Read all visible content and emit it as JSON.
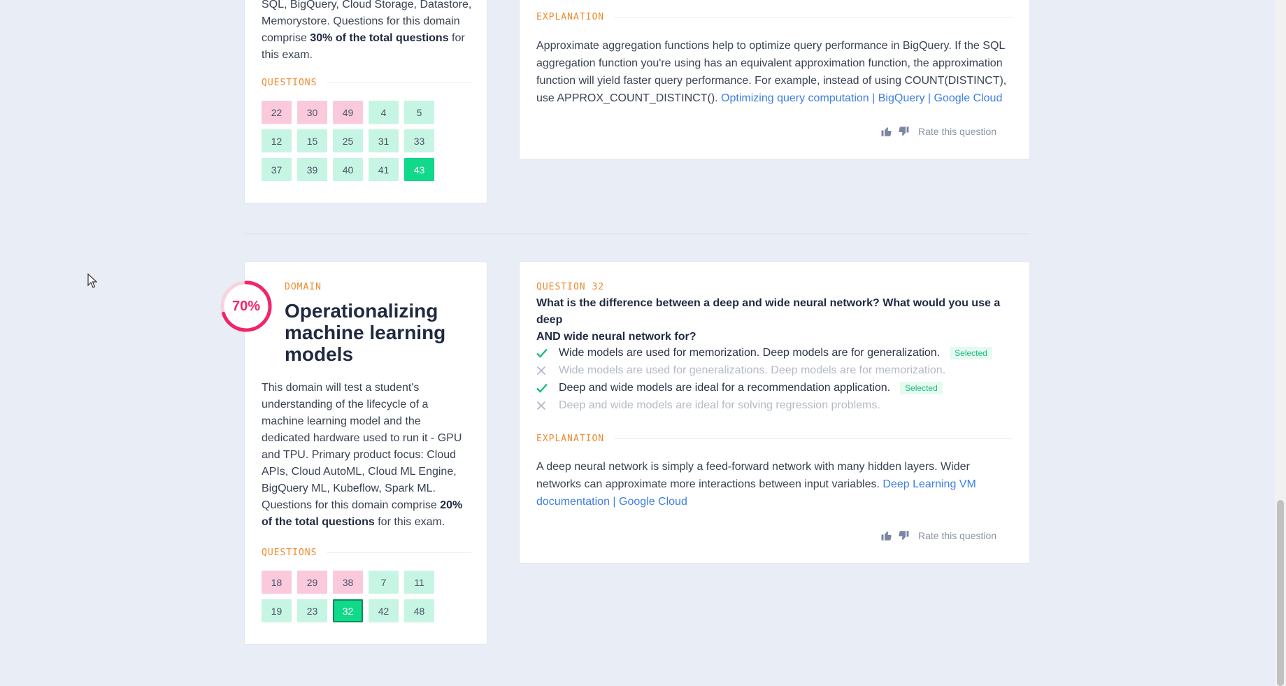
{
  "colors": {
    "accent_orange": "#f08a2d",
    "pink": "#fbc9dc",
    "green_light": "#c7f5e3",
    "green_active": "#10d98a",
    "link": "#3d7ee0",
    "donut": "#f0256a"
  },
  "domain1": {
    "desc_lines": [
      "SQL, BigQuery, Cloud Storage, Datastore,",
      "Memorystore. Questions for this domain"
    ],
    "desc_pre": "comprise ",
    "desc_bold": "30% of the total questions",
    "desc_post": " for",
    "desc_last": "this exam.",
    "questions_label": "QUESTIONS",
    "questions": [
      {
        "n": "22",
        "s": "pink"
      },
      {
        "n": "30",
        "s": "pink"
      },
      {
        "n": "49",
        "s": "pink"
      },
      {
        "n": "4",
        "s": "green"
      },
      {
        "n": "5",
        "s": "green"
      },
      {
        "n": "12",
        "s": "green"
      },
      {
        "n": "15",
        "s": "green"
      },
      {
        "n": "25",
        "s": "green"
      },
      {
        "n": "31",
        "s": "green"
      },
      {
        "n": "33",
        "s": "green"
      },
      {
        "n": "37",
        "s": "green"
      },
      {
        "n": "39",
        "s": "green"
      },
      {
        "n": "40",
        "s": "green"
      },
      {
        "n": "41",
        "s": "green"
      },
      {
        "n": "43",
        "s": "active"
      }
    ]
  },
  "explanation1": {
    "label": "EXPLANATION",
    "lines": [
      "Approximate aggregation functions help to optimize query performance in BigQuery. If the SQL",
      "aggregation function you're using has an equivalent approximation function, the approximation",
      "function will yield faster query performance. For example, instead of using COUNT(DISTINCT),"
    ],
    "last_pre": "use APPROX_COUNT_DISTINCT(). ",
    "link": "Optimizing query computation | BigQuery | Google Cloud",
    "rate_label": "Rate this question"
  },
  "domain2": {
    "percent": "70%",
    "percent_value": 0.7,
    "label": "DOMAIN",
    "title_lines": [
      "Operationalizing",
      "machine learning",
      "models"
    ],
    "desc_lines": [
      "This domain will test a student's",
      "understanding of the lifecycle of a",
      "machine learning model and the",
      "dedicated hardware used to run it - GPU",
      "and TPU. Primary product focus: Cloud",
      "APIs, Cloud AutoML, Cloud ML Engine,",
      "BigQuery ML, Kubeflow, Spark ML."
    ],
    "desc_pre": "Questions for this domain comprise ",
    "desc_bold1": "20%",
    "desc_bold2": "of the total questions",
    "desc_post": " for this exam.",
    "questions_label": "QUESTIONS",
    "questions": [
      {
        "n": "18",
        "s": "pink"
      },
      {
        "n": "29",
        "s": "pink"
      },
      {
        "n": "38",
        "s": "pink"
      },
      {
        "n": "7",
        "s": "green"
      },
      {
        "n": "11",
        "s": "green"
      },
      {
        "n": "19",
        "s": "green"
      },
      {
        "n": "23",
        "s": "green"
      },
      {
        "n": "32",
        "s": "active-b"
      },
      {
        "n": "42",
        "s": "green"
      },
      {
        "n": "48",
        "s": "green"
      }
    ]
  },
  "question32": {
    "label": "QUESTION 32",
    "title_lines": [
      "What is the difference between a deep and wide neural network? What would you use a deep",
      "AND wide neural network for?"
    ],
    "answers": [
      {
        "text": "Wide models are used for memorization. Deep models are for generalization.",
        "correct": true,
        "selected": true,
        "badge": "Selected"
      },
      {
        "text": "Wide models are used for generalizations. Deep models are for memorization.",
        "correct": false,
        "selected": false,
        "badge": ""
      },
      {
        "text": "Deep and wide models are ideal for a recommendation application.",
        "correct": true,
        "selected": true,
        "badge": "Selected"
      },
      {
        "text": "Deep and wide models are ideal for solving regression problems.",
        "correct": false,
        "selected": false,
        "badge": ""
      }
    ],
    "explanation_label": "EXPLANATION",
    "exp_lines": [
      "A deep neural network is simply a feed-forward network with many hidden layers. Wider"
    ],
    "exp_pre": "networks can approximate more interactions between input variables. ",
    "link_part1": "Deep Learning VM",
    "link_part2": "documentation | Google Cloud",
    "rate_label": "Rate this question"
  }
}
